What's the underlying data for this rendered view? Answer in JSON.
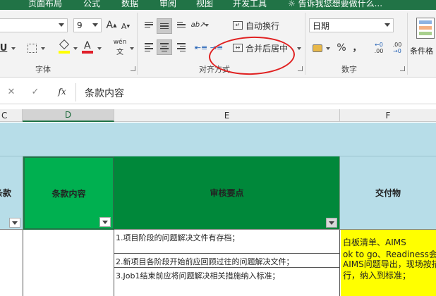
{
  "ribbon_tabs": [
    "页面布局",
    "公式",
    "数据",
    "审阅",
    "视图",
    "开发工具"
  ],
  "tell_me": "告诉我您想要做什么...",
  "font": {
    "size_value": "9",
    "grow_label": "A",
    "shrink_label": "A",
    "underline_label": "U",
    "font_color_label": "A",
    "phonetic_label": "wén"
  },
  "alignment": {
    "wrap_text_label": "自动换行",
    "merge_center_label": "合并后居中"
  },
  "number": {
    "format_value": "日期",
    "percent_label": "%",
    "comma_label": "，",
    "inc_decimal_label": ".00",
    "dec_decimal_label": ".00"
  },
  "styles": {
    "conditional_format_label": "条件格"
  },
  "group_labels": {
    "font": "字体",
    "alignment": "对齐方式",
    "number": "数字"
  },
  "formula_bar": {
    "fx_label": "fx",
    "content": "条款内容"
  },
  "columns": [
    "C",
    "D",
    "E",
    "F"
  ],
  "headers": {
    "c": "条款",
    "d": "条款内容",
    "e": "审核要点",
    "f": "交付物"
  },
  "rows": [
    {
      "e": "1.项目阶段的问题解决文件有存档；"
    },
    {
      "e": "2.新项目各阶段开始前应回顾过往的问题解决文件；"
    },
    {
      "e": "3.Job1结束前应将问题解决相关措施纳入标准；"
    }
  ],
  "deliverables": {
    "line1": "白板清单、AIMS",
    "line2": "ok to go、Readiness会",
    "line3": "AIMS问题导出，现场按措",
    "line4": "行，纳入到标准；"
  },
  "colors": {
    "excel_green": "#217346",
    "header_band": "#b7dde8",
    "col_d_fill": "#00b050",
    "col_e_fill": "#00883a",
    "highlight_yellow": "#ffff00",
    "annotation_red": "#e02020",
    "font_color_swatch": "#e0202a",
    "fill_color_swatch": "#ffff00"
  }
}
